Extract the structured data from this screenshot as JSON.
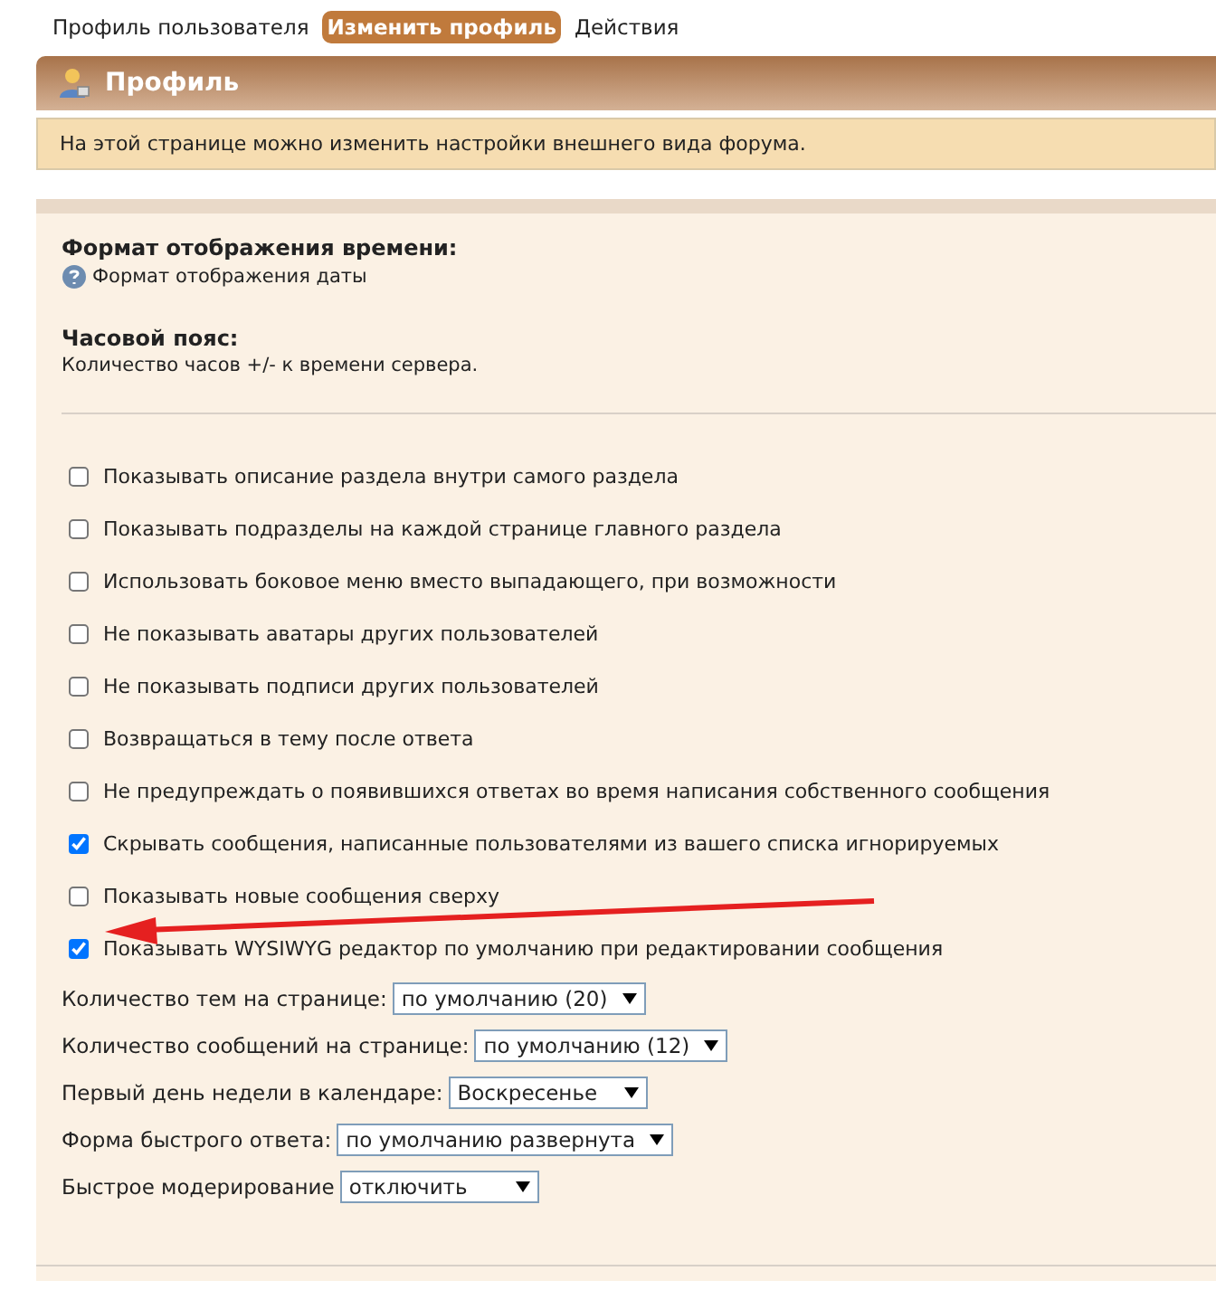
{
  "tabs": [
    {
      "label": "Профиль пользователя",
      "selected": false
    },
    {
      "label": "Изменить профиль",
      "selected": true
    },
    {
      "label": "Действия",
      "selected": false
    }
  ],
  "panel": {
    "title": "Профиль",
    "info": "На этой странице можно изменить настройки внешнего вида форума.",
    "fields": [
      {
        "label": "Формат отображения времени:",
        "hint": "Формат отображения даты",
        "help": true
      },
      {
        "label": "Часовой пояс:",
        "hint": "Количество часов +/- к времени сервера.",
        "help": false
      }
    ],
    "options": [
      {
        "label": "Показывать описание раздела внутри самого раздела",
        "checked": false
      },
      {
        "label": "Показывать подразделы на каждой странице главного раздела",
        "checked": false
      },
      {
        "label": "Использовать боковое меню вместо выпадающего, при возможности",
        "checked": false
      },
      {
        "label": "Не показывать аватары других пользователей",
        "checked": false
      },
      {
        "label": "Не показывать подписи других пользователей",
        "checked": false
      },
      {
        "label": "Возвращаться в тему после ответа",
        "checked": false
      },
      {
        "label": "Не предупреждать о появившихся ответах во время написания собственного сообщения",
        "checked": false
      },
      {
        "label": "Скрывать сообщения, написанные пользователями из вашего списка игнорируемых",
        "checked": true
      },
      {
        "label": "Показывать новые сообщения сверху",
        "checked": false
      },
      {
        "label": "Показывать WYSIWYG редактор по умолчанию при редактировании сообщения",
        "checked": true
      }
    ],
    "selects": [
      {
        "label": "Количество тем на странице:",
        "value": "по умолчанию (20)"
      },
      {
        "label": "Количество сообщений на странице:",
        "value": "по умолчанию (12)"
      },
      {
        "label": "Первый день недели в календаре:",
        "value": "Воскресенье"
      },
      {
        "label": "Форма быстрого ответа:",
        "value": "по умолчанию развернута"
      },
      {
        "label": "Быстрое модерирование",
        "value": "отключить"
      }
    ]
  }
}
